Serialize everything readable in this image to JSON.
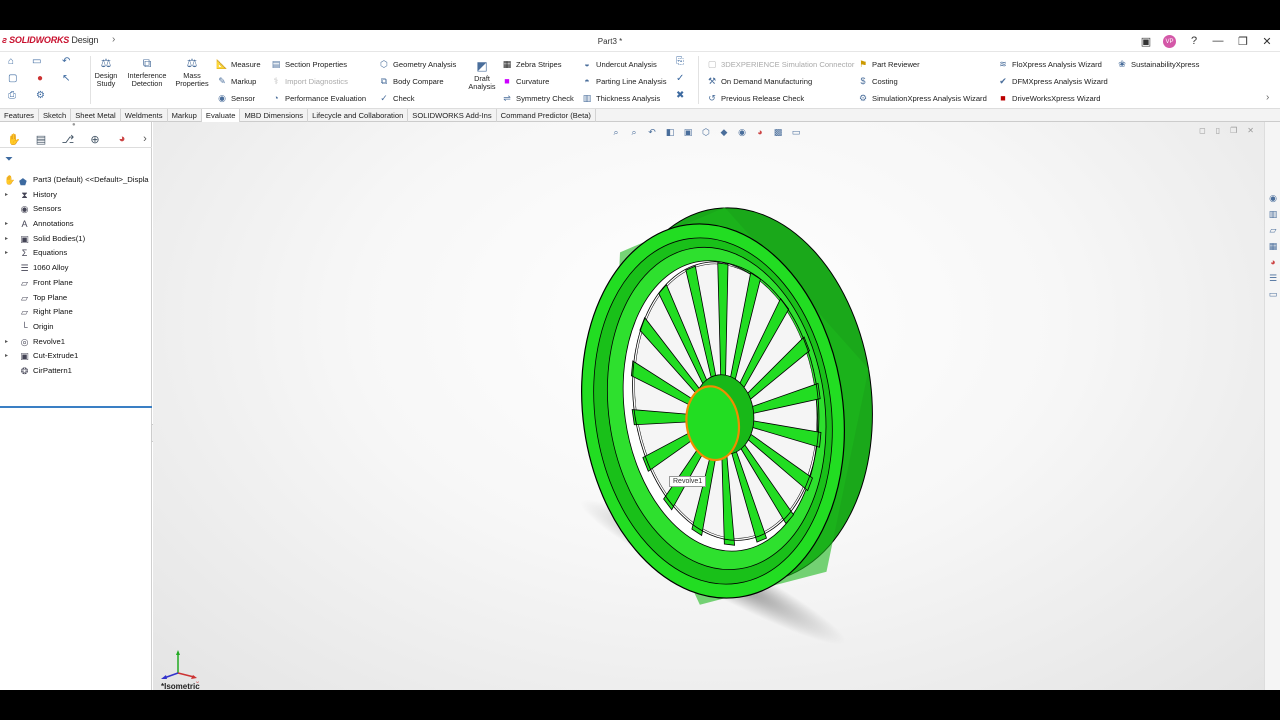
{
  "app": {
    "logo_brand": "SOLIDWORKS",
    "logo_suffix": "Design",
    "document_title": "Part3 *",
    "avatar_initials": "VP"
  },
  "ribbon": {
    "design_study": "Design Study",
    "interference_detection": "Interference Detection",
    "mass_properties": "Mass Properties",
    "measure": "Measure",
    "markup": "Markup",
    "sensor": "Sensor",
    "section_properties": "Section Properties",
    "import_diagnostics": "Import Diagnostics",
    "performance_evaluation": "Performance Evaluation",
    "geometry_analysis": "Geometry Analysis",
    "body_compare": "Body Compare",
    "check": "Check",
    "draft_analysis": "Draft Analysis",
    "zebra_stripes": "Zebra Stripes",
    "curvature": "Curvature",
    "symmetry_check": "Symmetry Check",
    "undercut_analysis": "Undercut Analysis",
    "parting_line_analysis": "Parting Line Analysis",
    "thickness_analysis": "Thickness Analysis",
    "simulation_connector": "3DEXPERIENCE Simulation Connector",
    "on_demand_manufacturing": "On Demand Manufacturing",
    "previous_release_check": "Previous Release Check",
    "part_reviewer": "Part Reviewer",
    "costing": "Costing",
    "simulationxpress": "SimulationXpress Analysis Wizard",
    "floxpress": "FloXpress Analysis Wizard",
    "dfmxpress": "DFMXpress Analysis Wizard",
    "driveworksxpress": "DriveWorksXpress Wizard",
    "sustainabilityxpress": "SustainabilityXpress"
  },
  "tabs": [
    "Features",
    "Sketch",
    "Sheet Metal",
    "Weldments",
    "Markup",
    "Evaluate",
    "MBD Dimensions",
    "Lifecycle and Collaboration",
    "SOLIDWORKS Add-Ins",
    "Command Predictor (Beta)"
  ],
  "active_tab": "Evaluate",
  "tree": {
    "root": "Part3 (Default) <<Default>_Displa",
    "items": [
      "History",
      "Sensors",
      "Annotations",
      "Solid Bodies(1)",
      "Equations",
      "1060 Alloy",
      "Front Plane",
      "Top Plane",
      "Right Plane",
      "Origin",
      "Revolve1",
      "Cut-Extrude1",
      "CirPattern1"
    ]
  },
  "viewport": {
    "tooltip": "Revolve1",
    "view_name": "*Isometric",
    "model_color": "#22dd22",
    "highlight_color": "#f08c00"
  }
}
